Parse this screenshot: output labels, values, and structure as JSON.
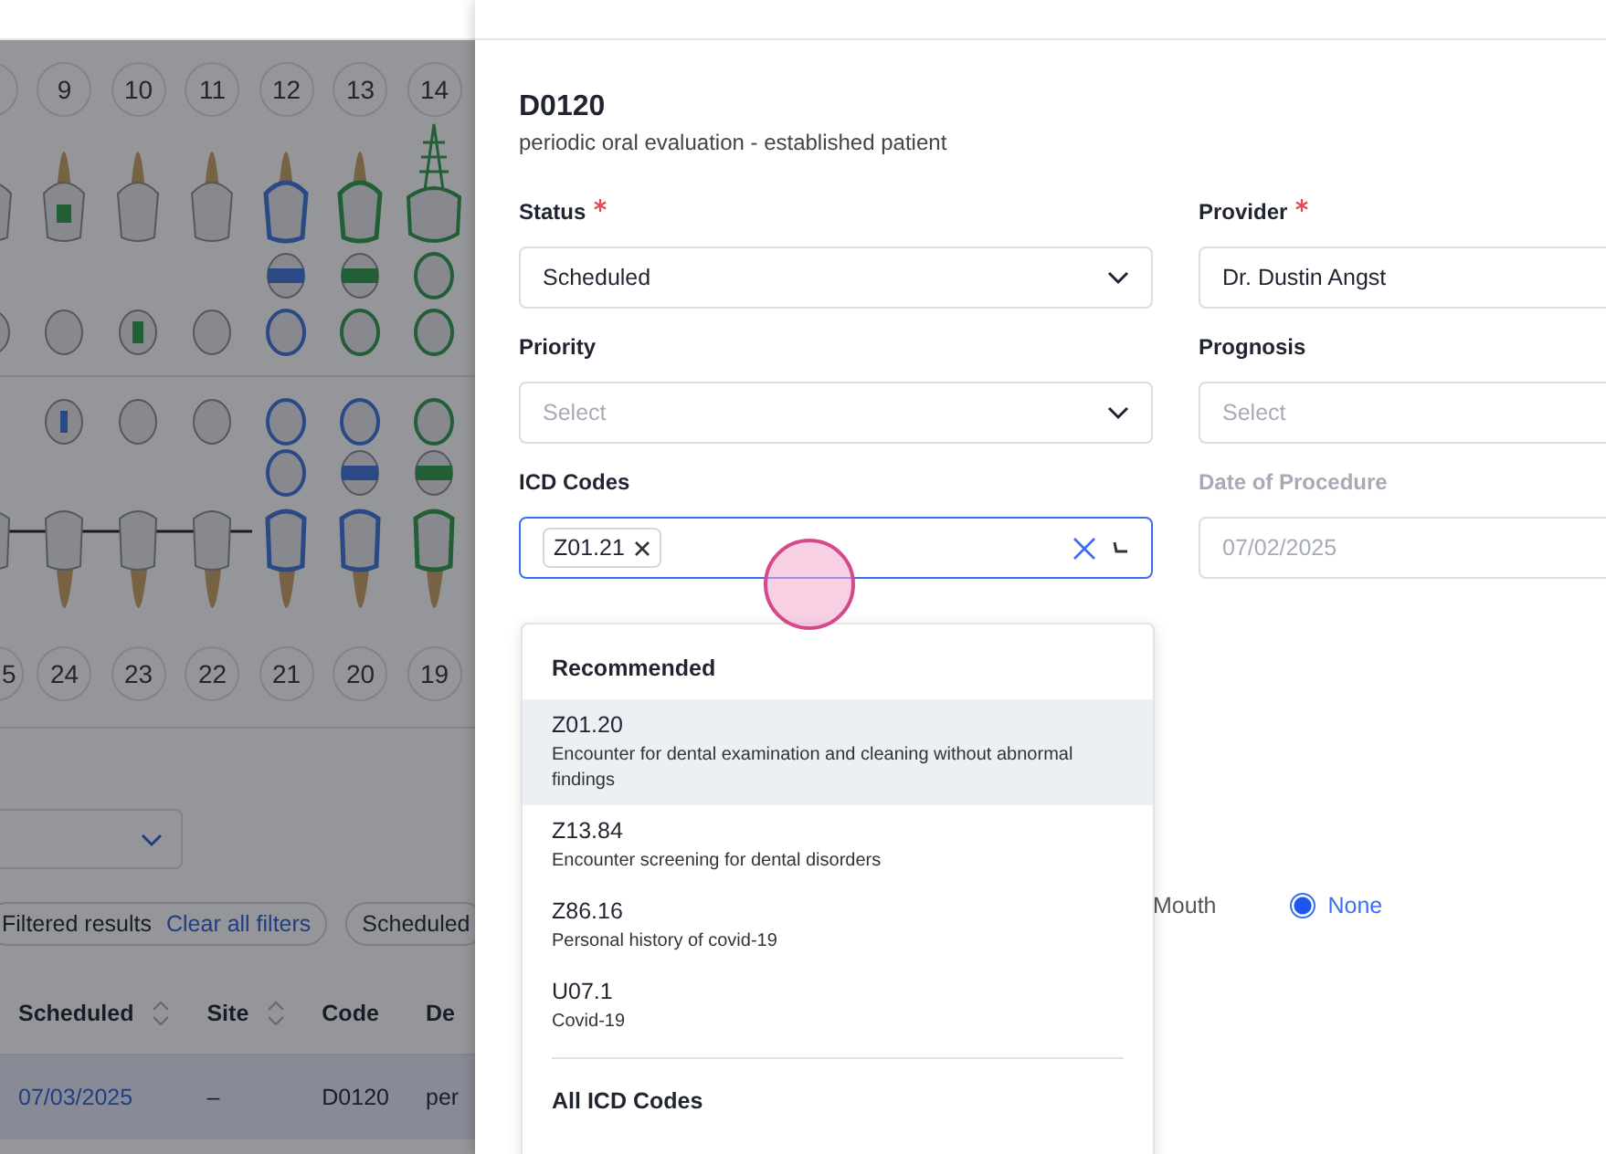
{
  "chart": {
    "upper_numbers": [
      "9",
      "10",
      "11",
      "12",
      "13",
      "14"
    ],
    "lower_numbers": [
      "5",
      "24",
      "23",
      "22",
      "21",
      "20",
      "19"
    ]
  },
  "filters": {
    "chips": [
      {
        "label": "Filtered results",
        "link": "Clear all filters"
      },
      {
        "label": "Scheduled"
      }
    ]
  },
  "table": {
    "columns": [
      {
        "label": "Scheduled",
        "sortable": true
      },
      {
        "label": "Site",
        "sortable": true
      },
      {
        "label": "Code",
        "sortable": false
      },
      {
        "label": "De",
        "sortable": false
      }
    ],
    "rows": [
      {
        "selected": true,
        "cells": [
          "07/03/2025",
          "–",
          "D0120",
          "per"
        ]
      }
    ]
  },
  "procedure": {
    "code": "D0120",
    "description": "periodic oral evaluation - established patient"
  },
  "fields": [
    {
      "label": "Status",
      "required": true,
      "kind": "select",
      "value": "Scheduled",
      "disabled": false
    },
    {
      "label": "Provider",
      "required": true,
      "kind": "text",
      "value": "Dr. Dustin Angst",
      "disabled": false
    },
    {
      "label": "Priority",
      "required": false,
      "kind": "select",
      "placeholder": "Select",
      "disabled": false
    },
    {
      "label": "Prognosis",
      "required": false,
      "kind": "text",
      "placeholder": "Select",
      "disabled": false
    },
    {
      "label": "ICD Codes",
      "required": false,
      "kind": "multiselect",
      "tags": [
        "Z01.21"
      ],
      "focused": true,
      "disabled": false
    },
    {
      "label": "Date of Procedure",
      "required": false,
      "kind": "text",
      "value": "07/02/2025",
      "disabled": true
    }
  ],
  "radio_options": [
    {
      "label": "Mouth",
      "selected": false
    },
    {
      "label": "None",
      "selected": true
    }
  ],
  "icd_dropdown": {
    "sections": [
      {
        "heading": "Recommended",
        "options": [
          {
            "code": "Z01.20",
            "description": "Encounter for dental examination and cleaning without abnormal findings",
            "highlighted": true
          },
          {
            "code": "Z13.84",
            "description": "Encounter screening for dental disorders",
            "highlighted": false
          },
          {
            "code": "Z86.16",
            "description": "Personal history of covid-19",
            "highlighted": false
          },
          {
            "code": "U07.1",
            "description": "Covid-19",
            "highlighted": false
          }
        ]
      },
      {
        "heading": "All ICD Codes"
      }
    ]
  }
}
